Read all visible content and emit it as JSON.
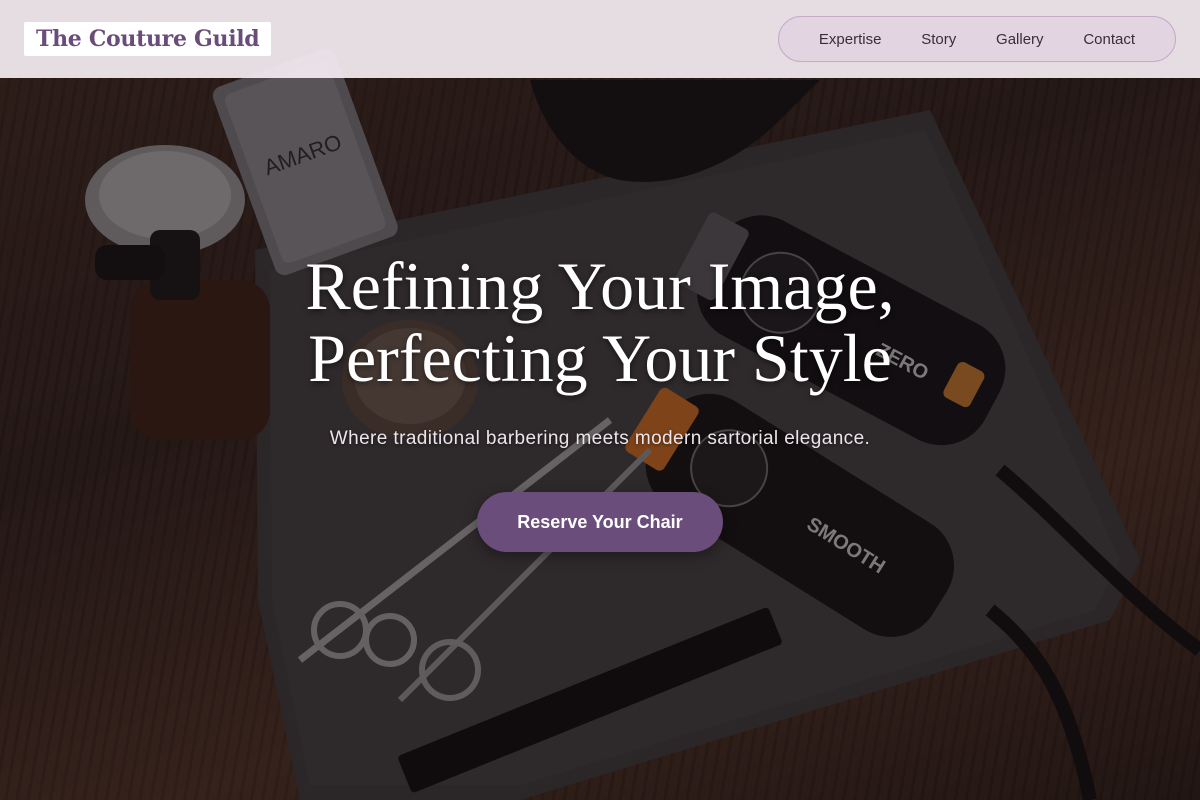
{
  "header": {
    "brand": "The Couture Guild",
    "nav": [
      {
        "label": "Expertise"
      },
      {
        "label": "Story"
      },
      {
        "label": "Gallery"
      },
      {
        "label": "Contact"
      }
    ]
  },
  "hero": {
    "title_line1": "Refining Your Image,",
    "title_line2": "Perfecting Your Style",
    "subtitle": "Where traditional barbering meets modern sartorial elegance.",
    "cta_label": "Reserve Your Chair",
    "image_text": {
      "tube_brand": "AMARO",
      "clipper_top_brand": "ZERO",
      "clipper_bottom_brand": "SMOOTH"
    }
  },
  "colors": {
    "accent": "#6b4d7c",
    "brand_text": "#6a4c7b",
    "header_bg": "#f2eaf0",
    "nav_border": "#c7a9c8"
  }
}
